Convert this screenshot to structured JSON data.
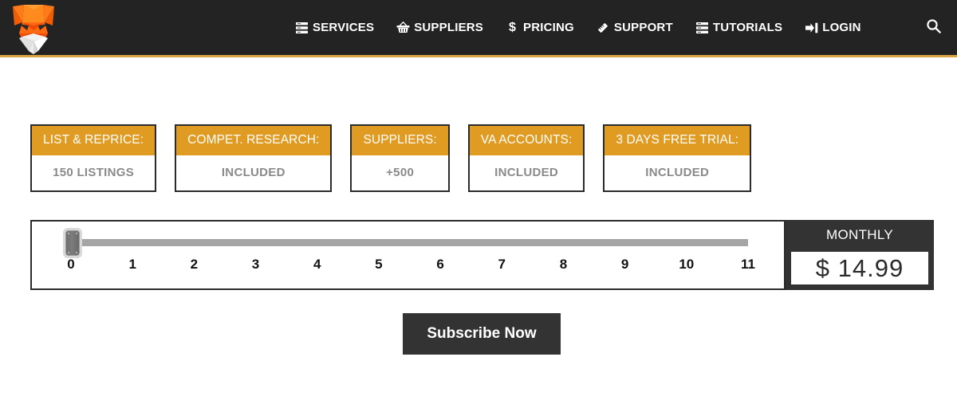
{
  "navbar": {
    "logo_name": "fox-logo",
    "links": [
      {
        "label": "SERVICES",
        "icon": "server-stack-icon"
      },
      {
        "label": "SUPPLIERS",
        "icon": "basket-icon"
      },
      {
        "label": "PRICING",
        "icon": "dollar-icon"
      },
      {
        "label": "SUPPORT",
        "icon": "pencil-ruler-icon"
      },
      {
        "label": "TUTORIALS",
        "icon": "server-stack-icon"
      },
      {
        "label": "LOGIN",
        "icon": "sign-in-icon"
      }
    ],
    "search_icon": "search-icon",
    "background_color": "#232323",
    "accent_border_color": "#d9a441"
  },
  "cards": [
    {
      "title": "LIST & REPRICE:",
      "value": "150 LISTINGS"
    },
    {
      "title": "COMPET. RESEARCH:",
      "value": "INCLUDED"
    },
    {
      "title": "SUPPLIERS:",
      "value": "+500"
    },
    {
      "title": "VA ACCOUNTS:",
      "value": "INCLUDED"
    },
    {
      "title": "3 DAYS FREE TRIAL:",
      "value": "INCLUDED"
    }
  ],
  "card_style": {
    "header_color": "#e09b23",
    "value_color": "#8a8a8a",
    "border_color": "#2b2b2b"
  },
  "slider": {
    "tick_labels": [
      "0",
      "1",
      "2",
      "3",
      "4",
      "5",
      "6",
      "7",
      "8",
      "9",
      "10",
      "11"
    ],
    "current_value": "0",
    "min": "0",
    "max": "11",
    "track_color": "#a5a5a5",
    "handle_name": "slider-handle"
  },
  "price": {
    "period_label": "MONTHLY",
    "amount": "$ 14.99",
    "panel_color": "#333333"
  },
  "subscribe": {
    "label": "Subscribe Now",
    "background_color": "#333333"
  }
}
